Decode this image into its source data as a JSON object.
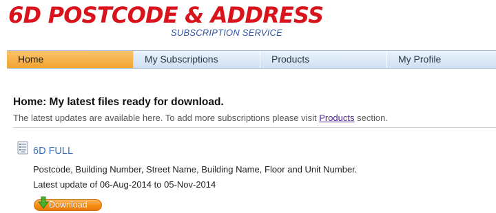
{
  "header": {
    "logo_title": "6D POSTCODE & ADDRESS",
    "logo_subtitle": "SUBSCRIPTION SERVICE"
  },
  "nav": {
    "tabs": [
      {
        "label": "Home",
        "active": true
      },
      {
        "label": "My Subscriptions",
        "active": false
      },
      {
        "label": "Products",
        "active": false
      },
      {
        "label": "My Profile",
        "active": false
      }
    ]
  },
  "main": {
    "heading": "Home: My latest files ready for download.",
    "intro_before": "The latest updates are available here. To add more subscriptions please visit ",
    "intro_link": "Products",
    "intro_after": " section."
  },
  "subscription": {
    "title": "6D FULL",
    "description": "Postcode, Building Number, Street Name, Building Name, Floor and Unit Number.",
    "update_text": "Latest update of 06-Aug-2014 to 05-Nov-2014",
    "download_label": "Download",
    "icon": "document-list-icon"
  },
  "colors": {
    "logo_red": "#d9131b",
    "logo_blue": "#2f55a4",
    "nav_active": "#f3a331",
    "nav_bg": "#cfe0f3",
    "link_purple": "#4b1f8e",
    "title_blue": "#3a6fb8",
    "download_orange": "#f58d13",
    "download_arrow_green": "#4cae2a"
  }
}
